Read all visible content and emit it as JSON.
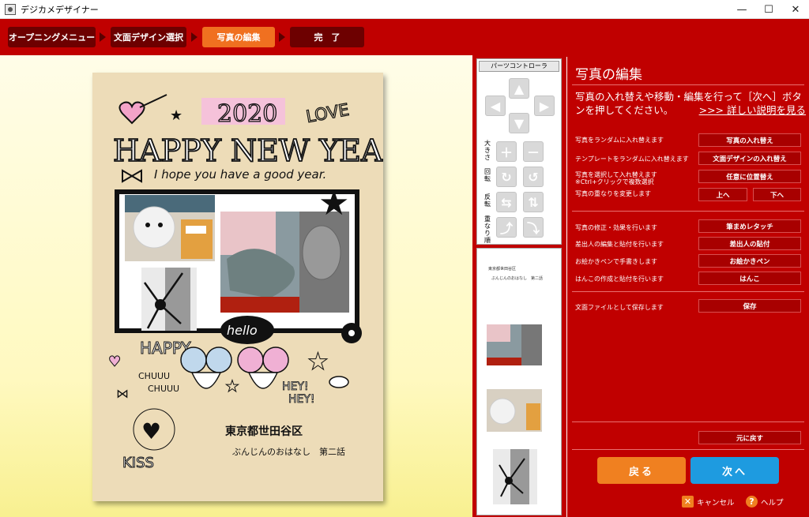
{
  "window": {
    "title": "デジカメデザイナー",
    "minimize": "—",
    "maximize": "☐",
    "close": "✕"
  },
  "steps": [
    {
      "label": "オープニングメニュー",
      "state": "done"
    },
    {
      "label": "文面デザイン選択",
      "state": "done"
    },
    {
      "label": "写真の編集",
      "state": "current"
    },
    {
      "label": "完　了",
      "state": "todo"
    }
  ],
  "parts_controller": {
    "title": "パーツコントローラ",
    "size_label": "大きさ",
    "rotate_label": "回転",
    "flip_label": "反転",
    "order_label": "重なり順"
  },
  "card": {
    "year": "2020",
    "greeting": "HAPPY NEW YEAR",
    "subtext": "I hope you have a good year.",
    "love": "LOVE",
    "happy": "HAPPY",
    "hello": "hello",
    "chuuu1": "CHUUU",
    "chuuu2": "CHUUU",
    "hey1": "HEY!",
    "hey2": "HEY!",
    "kiss": "KISS",
    "address": "東京都世田谷区",
    "name": "ぶんじんのおはなし　第二話"
  },
  "thumbs": {
    "address": "東京都世田谷区",
    "name": "ぶんじんのおはなし　第二話"
  },
  "panel": {
    "heading": "写真の編集",
    "description": "写真の入れ替えや移動・編集を行って［次へ］ボタンを押してください。",
    "link": ">>> 詳しい説明を見る",
    "rows": [
      {
        "label": "写真をランダムに入れ替えます",
        "button": "写真の入れ替え"
      },
      {
        "label": "テンプレートをランダムに入れ替えます",
        "button": "文面デザインの入れ替え"
      },
      {
        "label": "写真を選択して入れ替えます",
        "sublabel": "※Ctrl+クリックで複数選択",
        "button": "任意に位置替え"
      },
      {
        "label": "写真の重なりを変更します",
        "button_up": "上へ",
        "button_down": "下へ"
      },
      {
        "label": "写真の修正・効果を行います",
        "button": "筆まめレタッチ"
      },
      {
        "label": "差出人の編集と貼付を行います",
        "button": "差出人の貼付"
      },
      {
        "label": "お絵かきペンで手書きします",
        "button": "お絵かきペン"
      },
      {
        "label": "はんこの作成と貼付を行います",
        "button": "はんこ"
      },
      {
        "label": "文面ファイルとして保存します",
        "button": "保存"
      }
    ],
    "undo": "元に戻す",
    "back": "戻る",
    "next": "次へ",
    "cancel": "キャンセル",
    "help": "ヘルプ"
  },
  "colors": {
    "brand_red": "#c00000",
    "step_current": "#f07020",
    "back_button": "#f08020",
    "next_button": "#1e9be0"
  }
}
